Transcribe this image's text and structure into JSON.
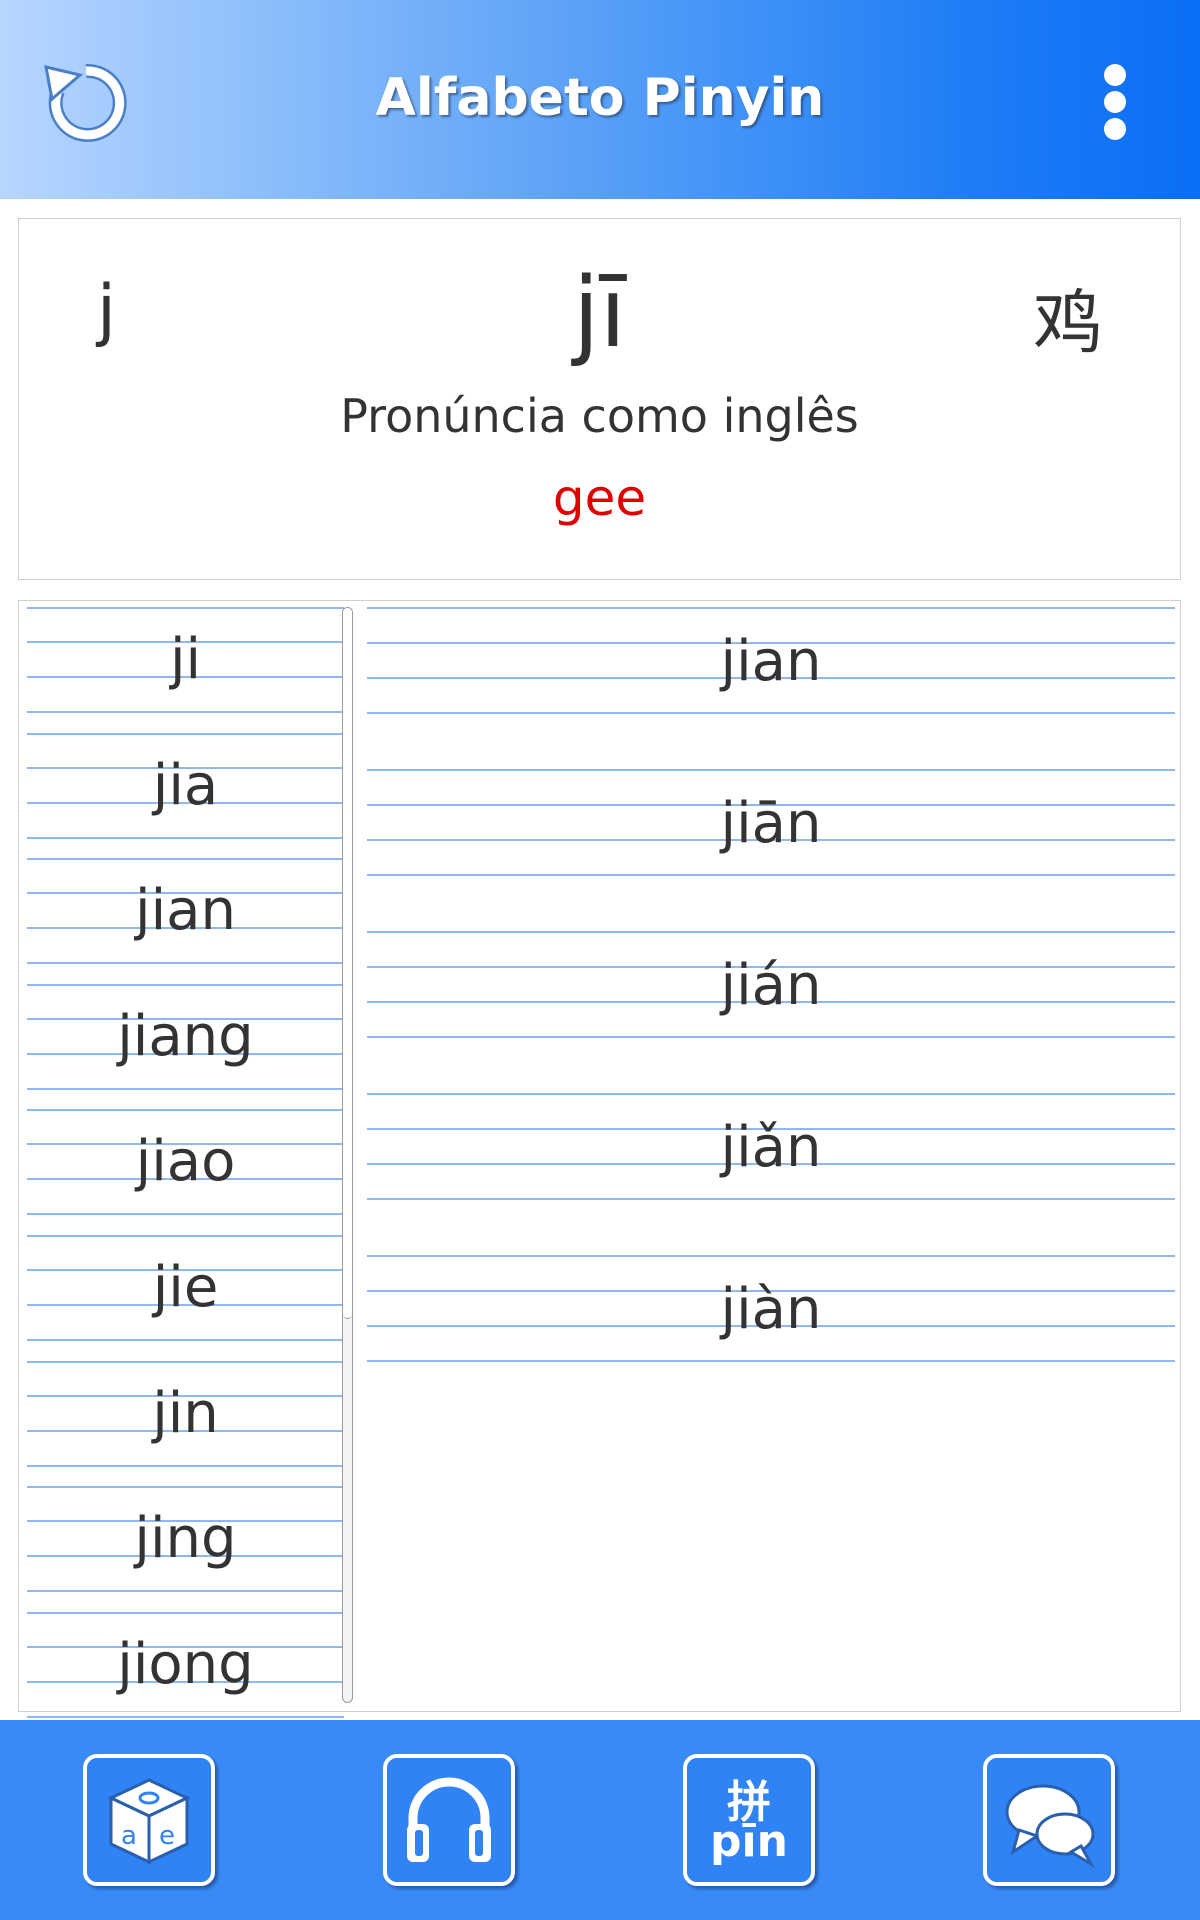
{
  "header": {
    "title": "Alfabeto Pinyin",
    "left_icon": "refresh-icon",
    "right_icon": "more-vert-icon"
  },
  "info": {
    "initial": "j",
    "syllable": "jī",
    "hanzi": "鸡",
    "pronunciation_label": "Pronúncia como inglês",
    "pronunciation_value": "gee"
  },
  "left_list": {
    "items": [
      "ji",
      "jia",
      "jian",
      "jiang",
      "jiao",
      "jie",
      "jin",
      "jing",
      "jiong"
    ]
  },
  "right_list": {
    "items": [
      "jian",
      "jiān",
      "jián",
      "jiǎn",
      "jiàn"
    ]
  },
  "toolbar": {
    "items": [
      {
        "icon": "dice-letters-icon"
      },
      {
        "icon": "headphones-icon"
      },
      {
        "icon": "pinyin-icon",
        "top": "拼",
        "bottom": "pīn"
      },
      {
        "icon": "chat-bubbles-icon"
      }
    ]
  },
  "colors": {
    "header_gradient_start": "#b7d6ff",
    "header_gradient_end": "#0a6ef5",
    "toolbar": "#3a8af6",
    "pronunciation_value": "#e00000",
    "rule_line": "#8fb8ee"
  }
}
